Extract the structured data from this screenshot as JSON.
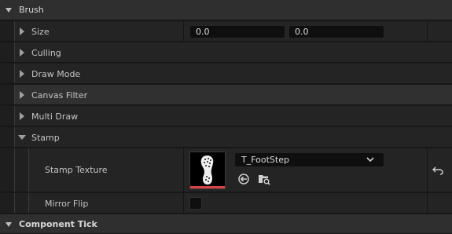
{
  "brush_section": {
    "label": "Brush"
  },
  "properties": {
    "size": {
      "label": "Size",
      "x_value": "0.0",
      "y_value": "0.0"
    },
    "culling": {
      "label": "Culling"
    },
    "draw_mode": {
      "label": "Draw Mode"
    },
    "canvas_filter": {
      "label": "Canvas Filter"
    },
    "multi_draw": {
      "label": "Multi Draw"
    },
    "stamp": {
      "label": "Stamp"
    },
    "stamp_texture": {
      "label": "Stamp Texture",
      "asset": "T_FootStep"
    },
    "mirror_flip": {
      "label": "Mirror Flip",
      "checked": false
    }
  },
  "component_tick_section": {
    "label": "Component Tick"
  },
  "icons": {
    "expand": "triangle-right-icon",
    "collapse": "triangle-down-icon",
    "browse": "browse-arrow-icon",
    "find": "find-in-browser-icon",
    "reset": "reset-to-default-icon",
    "dropdown": "chevron-down-icon"
  },
  "colors": {
    "accent_red": "#d64545"
  }
}
